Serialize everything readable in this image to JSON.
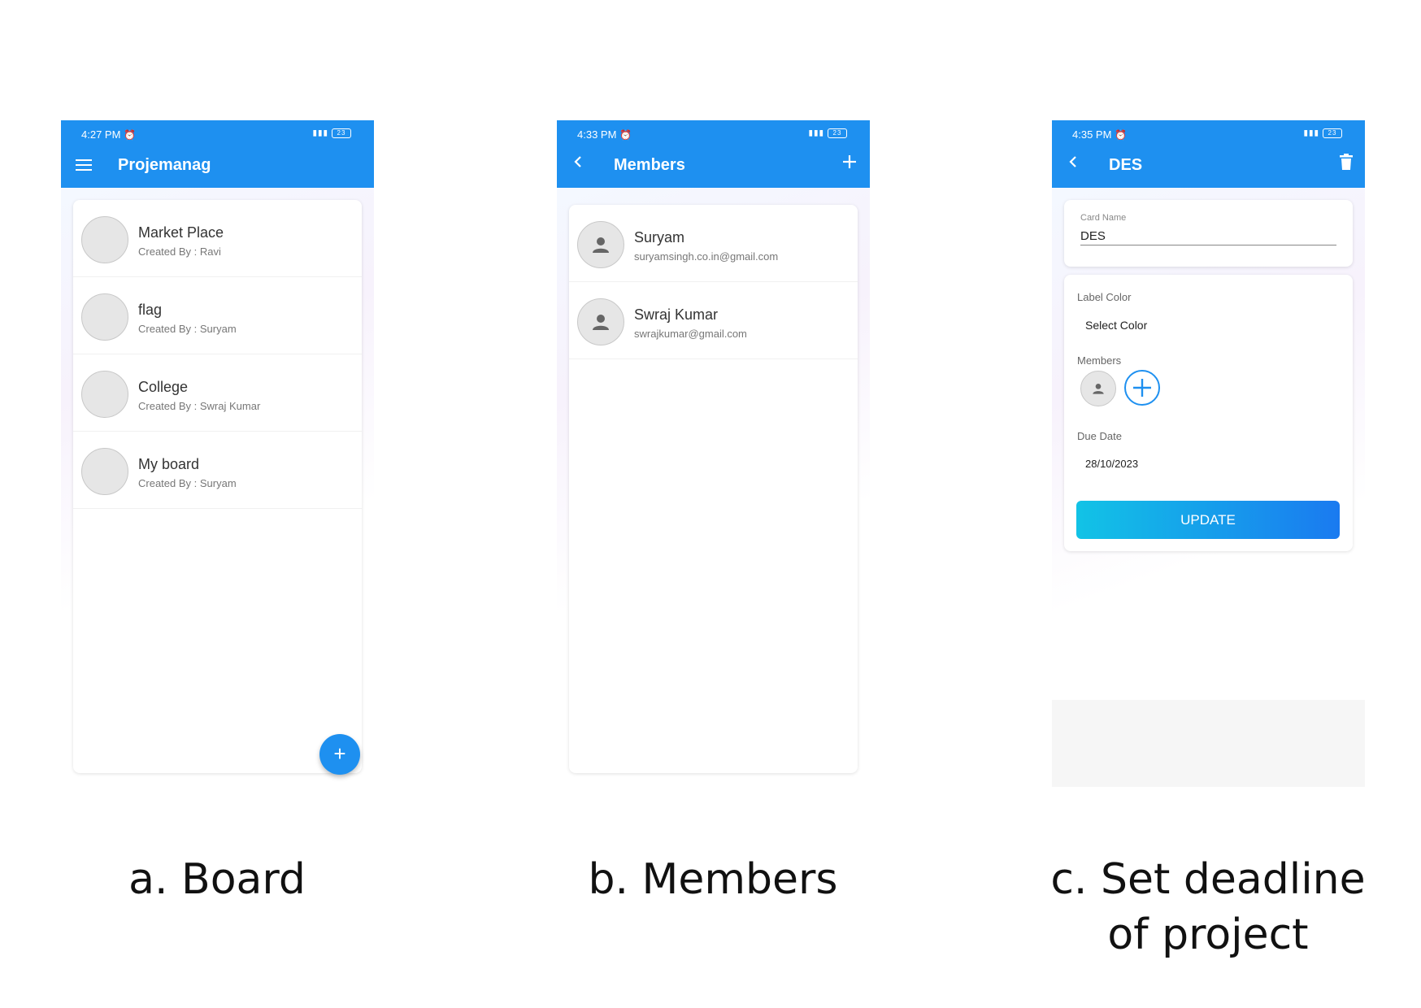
{
  "board": {
    "time": "4:27 PM",
    "title": "Projemanag",
    "items": [
      {
        "name": "Market Place",
        "created": "Created By : Ravi"
      },
      {
        "name": "flag",
        "created": "Created By : Suryam"
      },
      {
        "name": "College",
        "created": "Created By : Swraj Kumar"
      },
      {
        "name": "My board",
        "created": "Created By : Suryam"
      }
    ],
    "fab_label": "+",
    "caption": "a. Board"
  },
  "members": {
    "time": "4:33 PM",
    "title": "Members",
    "items": [
      {
        "name": "Suryam",
        "email": "suryamsingh.co.in@gmail.com"
      },
      {
        "name": "Swraj Kumar",
        "email": "swrajkumar@gmail.com"
      }
    ],
    "caption": "b. Members"
  },
  "card_detail": {
    "time": "4:35 PM",
    "title": "DES",
    "card_name_label": "Card Name",
    "card_name_value": "DES",
    "label_color_label": "Label Color",
    "select_color": "Select Color",
    "members_label": "Members",
    "due_date_label": "Due Date",
    "due_date_value": "28/10/2023",
    "update_label": "UPDATE",
    "caption_line1": "c. Set deadline",
    "caption_line2": "of project"
  },
  "status_battery": "23",
  "colors": {
    "primary": "#1e90f0",
    "gradient_start": "#12c3e6",
    "gradient_end": "#1a7af0"
  },
  "icons": [
    "menu-icon",
    "back-arrow-icon",
    "plus-icon",
    "trash-icon",
    "person-icon",
    "alarm-icon",
    "signal-icon",
    "battery-icon"
  ]
}
